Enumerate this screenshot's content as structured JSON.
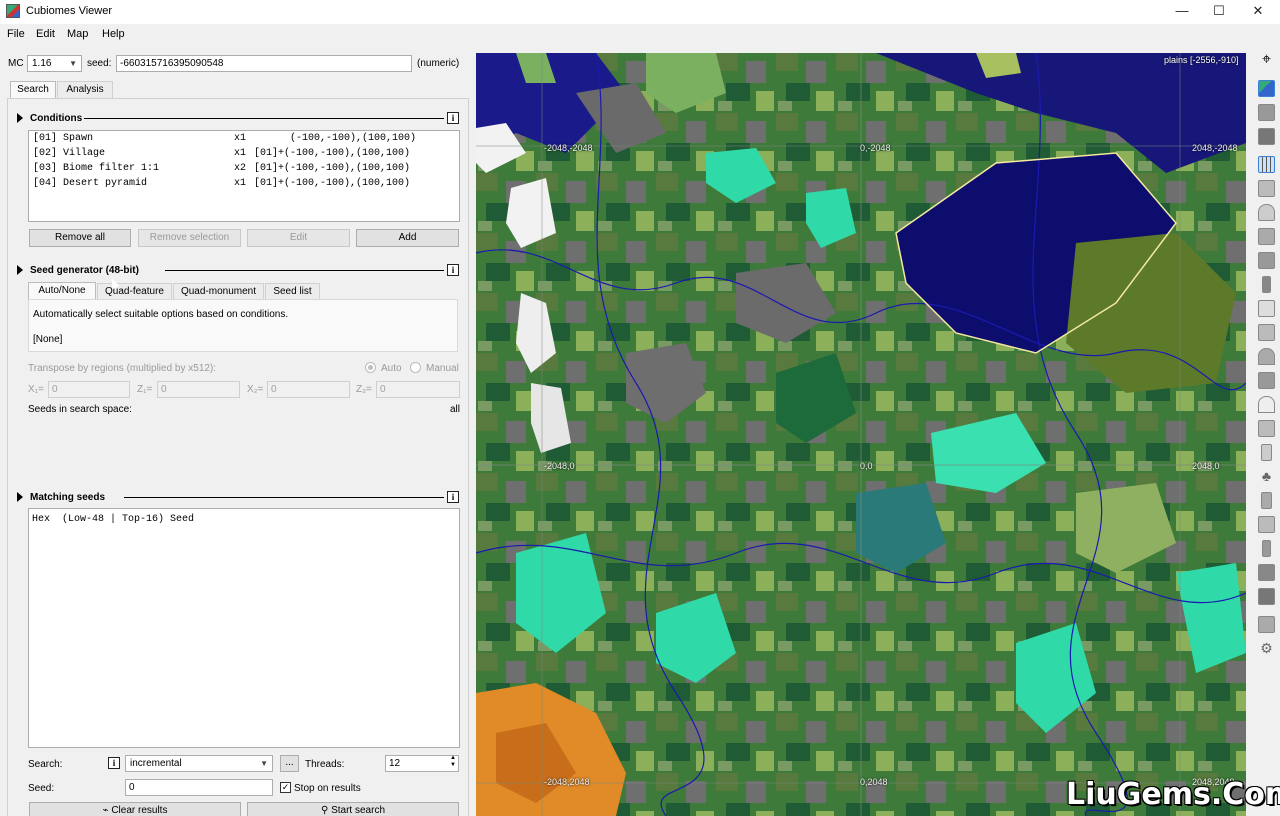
{
  "window": {
    "title": "Cubiomes Viewer",
    "minimize": "—",
    "maximize": "☐",
    "close": "✕"
  },
  "menu": [
    "File",
    "Edit",
    "Map",
    "Help"
  ],
  "mc": {
    "label": "MC",
    "version": "1.16",
    "seed_label": "seed:",
    "seed_value": "-660315716395090548",
    "seed_kind": "(numeric)"
  },
  "tabs": [
    "Search",
    "Analysis"
  ],
  "conditions": {
    "title": "Conditions",
    "rows": [
      {
        "id": "[01] Spawn",
        "count": "x1",
        "area": "      (-100,-100),(100,100)"
      },
      {
        "id": "[02] Village",
        "count": "x1",
        "area": "[01]+(-100,-100),(100,100)"
      },
      {
        "id": "[03] Biome filter 1:1",
        "count": "x2",
        "area": "[01]+(-100,-100),(100,100)"
      },
      {
        "id": "[04] Desert pyramid",
        "count": "x1",
        "area": "[01]+(-100,-100),(100,100)"
      }
    ],
    "buttons": {
      "remove_all": "Remove all",
      "remove_selection": "Remove selection",
      "edit": "Edit",
      "add": "Add"
    }
  },
  "seed_generator": {
    "title": "Seed generator (48-bit)",
    "tabs": [
      "Auto/None",
      "Quad-feature",
      "Quad-monument",
      "Seed list"
    ],
    "description": "Automatically select suitable options based on conditions.",
    "mode": "[None]",
    "transpose_label": "Transpose by regions (multiplied by x512):",
    "auto": "Auto",
    "manual": "Manual",
    "x1_label": "X₁=",
    "z1_label": "Z₁=",
    "x2_label": "X₂=",
    "z2_label": "Z₂=",
    "x1": "0",
    "z1": "0",
    "x2": "0",
    "z2": "0",
    "space_label": "Seeds in search space:",
    "space_value": "all"
  },
  "matching": {
    "title": "Matching seeds",
    "header": "Hex  (Low-48 | Top-16) Seed"
  },
  "search": {
    "label": "Search:",
    "mode": "incremental",
    "more": "...",
    "threads_label": "Threads:",
    "threads": "12",
    "seed_label": "Seed:",
    "seed": "0",
    "stop_label": "Stop on results",
    "stop_checked": true,
    "clear": "Clear results",
    "start": "Start search"
  },
  "map": {
    "info": "plains [-2556,-910]",
    "coords": [
      "-2048,-2048",
      "0,-2048",
      "2048,-2048",
      "-2048,0",
      "0,0",
      "2048,0",
      "-2048,2048",
      "0,2048",
      "2048,2048"
    ]
  },
  "watermark": "LiuGems.Com",
  "icons": [
    "crosshair-icon",
    "layer-icon",
    "grid-icon",
    "structure-icon"
  ]
}
